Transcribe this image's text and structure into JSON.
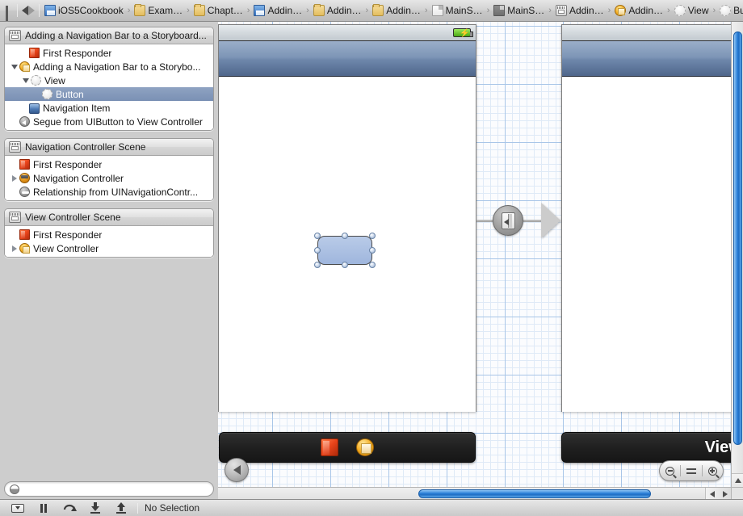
{
  "jumpbar": {
    "grid_icon": "grid-icon",
    "back_label": "Back",
    "forward_label": "Forward",
    "crumbs": [
      {
        "label": "iOS5Cookbook",
        "icon": "xcode-project-icon"
      },
      {
        "label": "Exam…",
        "icon": "folder-icon"
      },
      {
        "label": "Chapt…",
        "icon": "folder-icon"
      },
      {
        "label": "Addin…",
        "icon": "xcode-project-icon"
      },
      {
        "label": "Addin…",
        "icon": "folder-icon"
      },
      {
        "label": "Addin…",
        "icon": "folder-icon"
      },
      {
        "label": "MainS…",
        "icon": "file-icon"
      },
      {
        "label": "MainS…",
        "icon": "file-dark-icon"
      },
      {
        "label": "Addin…",
        "icon": "scene-icon"
      },
      {
        "label": "Addin…",
        "icon": "view-controller-icon"
      },
      {
        "label": "View",
        "icon": "view-icon"
      },
      {
        "label": "Button",
        "icon": "view-icon"
      }
    ],
    "separator": "›"
  },
  "outline": {
    "scenes": [
      {
        "title": "Adding a Navigation Bar to a Storyboard...",
        "header_icon": "scene-icon",
        "rows": [
          {
            "label": "First Responder",
            "icon": "first-responder-icon",
            "indent": 1,
            "disclosure": "none",
            "selected": false
          },
          {
            "label": "Adding a Navigation Bar to a Storybo...",
            "icon": "view-controller-icon",
            "indent": 0,
            "disclosure": "expanded",
            "selected": false
          },
          {
            "label": "View",
            "icon": "view-icon",
            "indent": 1,
            "disclosure": "expanded",
            "selected": false
          },
          {
            "label": "Button",
            "icon": "view-icon",
            "indent": 3,
            "disclosure": "none",
            "selected": true
          },
          {
            "label": "Navigation Item",
            "icon": "navigation-item-icon",
            "indent": 1,
            "disclosure": "none",
            "selected": false
          },
          {
            "label": "Segue from UIButton to View Controller",
            "icon": "segue-icon",
            "indent": 0,
            "disclosure": "none",
            "selected": false
          }
        ]
      },
      {
        "title": "Navigation Controller Scene",
        "header_icon": "scene-icon",
        "rows": [
          {
            "label": "First Responder",
            "icon": "first-responder-icon",
            "indent": 1,
            "disclosure": "none",
            "selected": false
          },
          {
            "label": "Navigation Controller",
            "icon": "navigation-controller-icon",
            "indent": 0,
            "disclosure": "collapsed",
            "selected": false
          },
          {
            "label": "Relationship from UINavigationContr...",
            "icon": "relationship-icon",
            "indent": 1,
            "disclosure": "none",
            "selected": false
          }
        ]
      },
      {
        "title": "View Controller Scene",
        "header_icon": "scene-icon",
        "rows": [
          {
            "label": "First Responder",
            "icon": "first-responder-icon",
            "indent": 1,
            "disclosure": "none",
            "selected": false
          },
          {
            "label": "View Controller",
            "icon": "view-controller-icon",
            "indent": 0,
            "disclosure": "collapsed",
            "selected": false
          }
        ]
      }
    ],
    "filter": {
      "placeholder": "",
      "value": "",
      "icon": "filter-icon"
    }
  },
  "canvas": {
    "left_scene": {
      "dock_title": "",
      "dock_items": [
        {
          "name": "first-responder",
          "icon": "first-responder-icon"
        },
        {
          "name": "view-controller",
          "icon": "view-controller-icon"
        }
      ],
      "status_bar": {
        "battery_icon": "battery-charging-icon"
      },
      "selected_object": {
        "name": "Button",
        "selected": true
      }
    },
    "right_scene": {
      "dock_title": "View Controll",
      "status_bar": {
        "battery_icon": ""
      }
    },
    "segue": {
      "type": "push",
      "icon": "push-segue-icon"
    },
    "zoom_controls": {
      "zoom_out_label": "zoom-out",
      "actual_size_label": "actual-size",
      "zoom_in_label": "zoom-in"
    },
    "back_button_label": "back"
  },
  "statusbar": {
    "debug_controls": [
      {
        "name": "scheme-menu",
        "icon": "dropdown-icon"
      },
      {
        "name": "pause",
        "icon": "pause-icon"
      },
      {
        "name": "step-over",
        "icon": "step-over-icon"
      },
      {
        "name": "step-into",
        "icon": "step-into-icon"
      },
      {
        "name": "step-out",
        "icon": "step-out-icon"
      }
    ],
    "selection_text": "No Selection"
  },
  "colors": {
    "panel_bg": "#cdcdcd",
    "selection_blue": "#7a90b4",
    "scrollbar_blue": "#2a7fd8",
    "nav_bar": "#6e87ab",
    "button_fill": "#9fb6dd"
  }
}
